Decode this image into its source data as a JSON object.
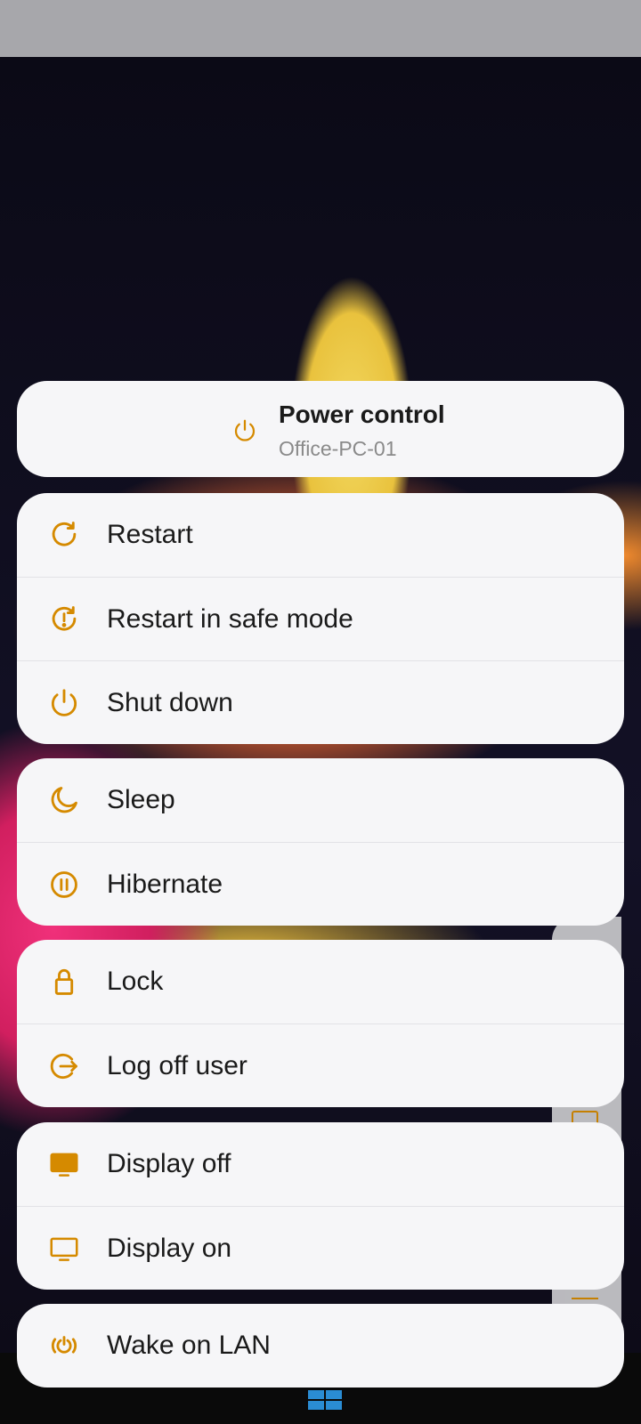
{
  "header": {
    "title": "Power control",
    "subtitle": "Office-PC-01",
    "icon": "power-icon"
  },
  "colors": {
    "accent": "#d58a00",
    "card_bg": "#f6f6f8",
    "text": "#1a1a1a",
    "subtext": "#8a8a8a"
  },
  "groups": [
    {
      "items": [
        {
          "label": "Restart",
          "icon": "restart-icon"
        },
        {
          "label": "Restart in safe mode",
          "icon": "restart-safe-mode-icon"
        },
        {
          "label": "Shut down",
          "icon": "power-icon"
        }
      ]
    },
    {
      "items": [
        {
          "label": "Sleep",
          "icon": "moon-icon"
        },
        {
          "label": "Hibernate",
          "icon": "pause-circle-icon"
        }
      ]
    },
    {
      "items": [
        {
          "label": "Lock",
          "icon": "lock-icon"
        },
        {
          "label": "Log off user",
          "icon": "logout-icon"
        }
      ]
    },
    {
      "items": [
        {
          "label": "Display off",
          "icon": "monitor-filled-icon"
        },
        {
          "label": "Display on",
          "icon": "monitor-icon"
        }
      ]
    },
    {
      "items": [
        {
          "label": "Wake on LAN",
          "icon": "wake-on-lan-icon"
        }
      ]
    }
  ]
}
